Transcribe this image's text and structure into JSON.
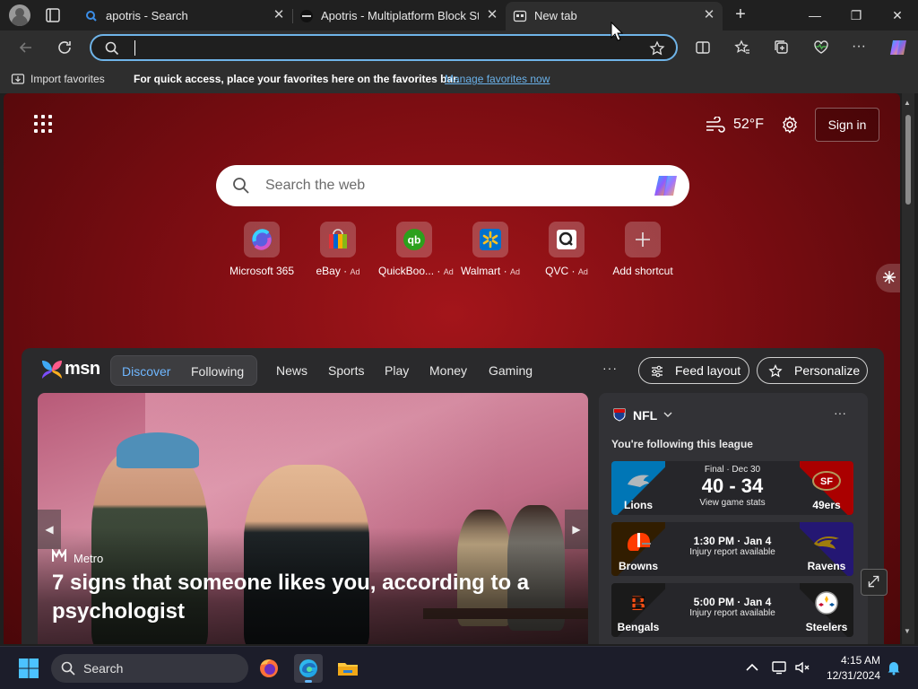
{
  "browser": {
    "tabs": [
      {
        "label": "apotris - Search"
      },
      {
        "label": "Apotris - Multiplatform Block Stac"
      },
      {
        "label": "New tab"
      }
    ],
    "address": {
      "value": ""
    },
    "favorites_bar": {
      "import_label": "Import favorites",
      "message": "For quick access, place your favorites here on the favorites bar.",
      "manage_link": "Manage favorites now"
    }
  },
  "ntp": {
    "weather": {
      "temp": "52°F"
    },
    "sign_in": "Sign in",
    "search": {
      "placeholder": "Search the web"
    },
    "shortcuts": [
      {
        "name": "Microsoft 365",
        "ad": ""
      },
      {
        "name": "eBay",
        "ad": "Ad"
      },
      {
        "name": "QuickBoo...",
        "ad": "Ad"
      },
      {
        "name": "Walmart",
        "ad": "Ad"
      },
      {
        "name": "QVC",
        "ad": "Ad"
      },
      {
        "name": "Add shortcut",
        "ad": ""
      }
    ]
  },
  "msn": {
    "logo": "msn",
    "pill": {
      "discover": "Discover",
      "following": "Following"
    },
    "nav": [
      "News",
      "Sports",
      "Play",
      "Money",
      "Gaming"
    ],
    "more": "···",
    "feed_layout": "Feed layout",
    "personalize": "Personalize",
    "hero": {
      "source": "Metro",
      "title": "7 signs that someone likes you, according to a psychologist"
    },
    "nfl": {
      "title": "NFL",
      "subtitle": "You're following this league",
      "games": [
        {
          "home": "Lions",
          "away": "49ers",
          "status": "Final · Dec 30",
          "score": "40 - 34",
          "note": "View game stats"
        },
        {
          "home": "Browns",
          "away": "Ravens",
          "time": "1:30 PM · Jan 4",
          "note": "Injury report available"
        },
        {
          "home": "Bengals",
          "away": "Steelers",
          "time": "5:00 PM · Jan 4",
          "note": "Injury report available"
        }
      ]
    }
  },
  "taskbar": {
    "search_label": "Search",
    "time": "4:15 AM",
    "date": "12/31/2024"
  }
}
